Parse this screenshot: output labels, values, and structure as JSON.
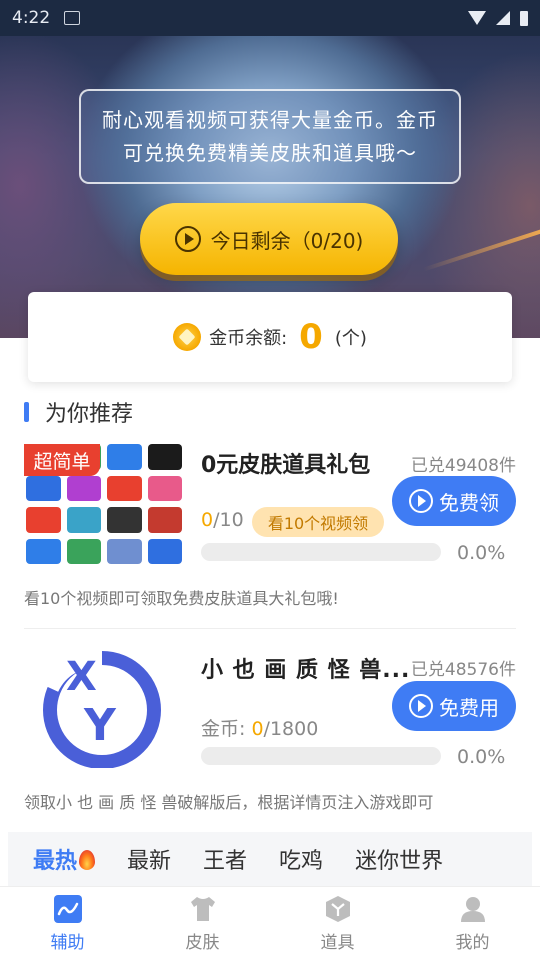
{
  "status_bar": {
    "time": "4:22"
  },
  "hero": {
    "notice": "耐心观看视频可获得大量金币。金币可兑换免费精美皮肤和道具哦～",
    "today_button": "今日剩余（0/20)"
  },
  "coin_card": {
    "label": "金币余额:",
    "value": "0",
    "unit": "(个)"
  },
  "section": {
    "title": "为你推荐"
  },
  "items": [
    {
      "badge": "超简单",
      "title": "0元皮肤道具礼包",
      "sold": "已兑49408件",
      "button": "免费领",
      "progress_current": "0",
      "progress_total": "/10",
      "tag": "看10个视频领",
      "progress_fraction": 0.0,
      "percent": "0.0%",
      "desc": "看10个视频即可领取免费皮肤道具大礼包哦!",
      "thumb_colors": [
        "#e8602f",
        "#3aa35b",
        "#2f7ee8",
        "#1b1b1b",
        "#2f6fe0",
        "#b03fd0",
        "#e8402f",
        "#e85a8a",
        "#e8402f",
        "#3aa3c8",
        "#333333",
        "#c43a2f",
        "#2f7ee8",
        "#3aa35b",
        "#6f8fd0",
        "#2f6fe0"
      ]
    },
    {
      "title": "小 也 画 质 怪 兽...",
      "sold": "已兑48576件",
      "button": "免费用",
      "progress_prefix": "金币: ",
      "progress_current": "0",
      "progress_total": "/1800",
      "progress_fraction": 0.0,
      "percent": "0.0%",
      "desc": "领取小 也 画 质 怪 兽破解版后，根据详情页注入游戏即可",
      "logo_text_x": "X",
      "logo_text_y": "Y"
    }
  ],
  "category_tabs": [
    "最热",
    "最新",
    "王者",
    "吃鸡",
    "迷你世界"
  ],
  "bottom_nav": [
    {
      "label": "辅助",
      "icon": "chart-line-icon"
    },
    {
      "label": "皮肤",
      "icon": "tshirt-icon"
    },
    {
      "label": "道具",
      "icon": "cube-icon"
    },
    {
      "label": "我的",
      "icon": "user-icon"
    }
  ],
  "colors": {
    "accent": "#3f7cf4",
    "gold": "#f5a800",
    "badge_red": "#e8402f"
  }
}
